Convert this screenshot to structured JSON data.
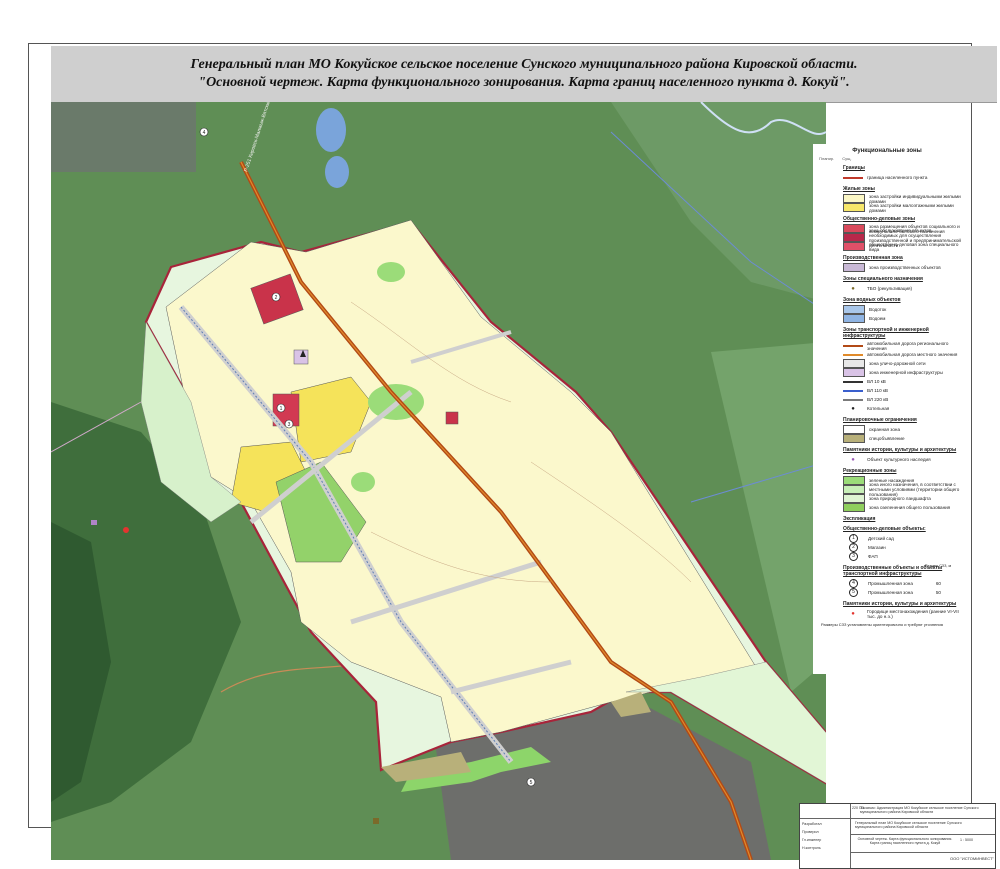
{
  "title": {
    "line1": "Генеральный план МО Кокуйское сельское поселение Сунского муниципального района Кировской области.",
    "line2": "\"Основной чертеж. Карта функционального зонирования. Карта границ населенного пункта д. Кокуй\"."
  },
  "map": {
    "road_label": "Р-251 Кировск-Малмыж-Вятские Поляны",
    "markers": [
      "1",
      "2",
      "3",
      "4",
      "5"
    ]
  },
  "legend": {
    "title": "Функциональные зоны",
    "col_headers": [
      "Планир.",
      "Сущ."
    ],
    "sections": [
      {
        "heading": "Границы",
        "items": [
          {
            "kind": "line",
            "color": "#c0392b",
            "label": "граница населенного пункта"
          }
        ]
      },
      {
        "heading": "Жилые зоны",
        "items": [
          {
            "kind": "fill",
            "color": "#fbf7c6",
            "label": "зона застройки индивидуальными жилыми домами"
          },
          {
            "kind": "fill",
            "color": "#f7e76a",
            "label": "зона застройки малоэтажными жилыми домами"
          }
        ]
      },
      {
        "heading": "Общественно-деловые зоны",
        "items": [
          {
            "kind": "fill",
            "color": "#d9495b",
            "label": "зона размещения объектов социального и коммунально-бытового назначения"
          },
          {
            "kind": "fill",
            "color": "#b8284a",
            "label": "зона обслуживания объектов, необходимых для осуществления производственной и предпринимательской деятельности"
          },
          {
            "kind": "fill",
            "color": "#e05068",
            "label": "общественно-деловая зона специального вида"
          }
        ]
      },
      {
        "heading": "Производственная зона",
        "items": [
          {
            "kind": "fill",
            "color": "#c9b9d6",
            "label": "зона производственных объектов"
          }
        ]
      },
      {
        "heading": "Зоны специального назначения",
        "items": [
          {
            "kind": "symbol",
            "color": "#7b6a2a",
            "label": "ТБО (рекультивация)"
          }
        ]
      },
      {
        "heading": "Зона водных объектов",
        "items": [
          {
            "kind": "fill",
            "color": "#a9c7ea",
            "label": "Водоток"
          },
          {
            "kind": "fill",
            "color": "#8fb4e3",
            "label": "Водоем"
          }
        ]
      },
      {
        "heading": "Зоны транспортной и инженерной инфраструктуры",
        "items": [
          {
            "kind": "line",
            "color": "#b24a16",
            "label": "автомобильная дорога регионального значения"
          },
          {
            "kind": "line",
            "color": "#e08a2a",
            "label": "автомобильная дорога местного значения"
          },
          {
            "kind": "fill",
            "color": "#e8e8e8",
            "label": "зона уличо-дорожной сети"
          },
          {
            "kind": "fill",
            "color": "#d9c3e6",
            "label": "зона инженерной инфраструктуры"
          },
          {
            "kind": "line",
            "color": "#333333",
            "label": "ВЛ 10 кВ"
          },
          {
            "kind": "line",
            "color": "#3a5fcd",
            "label": "ВЛ 110 кВ"
          },
          {
            "kind": "line",
            "color": "#7a7a7a",
            "label": "ВЛ 220 кВ"
          },
          {
            "kind": "symbol",
            "color": "#222222",
            "label": "Котельная"
          }
        ]
      },
      {
        "heading": "Планировочные ограничения",
        "items": [
          {
            "kind": "fill",
            "color": "#ffffff",
            "label": "охранная зона"
          },
          {
            "kind": "fill",
            "color": "#b8b07a",
            "label": "спецобъявление"
          }
        ]
      },
      {
        "heading": "Памятники истории, культуры и архитектуры",
        "items": [
          {
            "kind": "symbol",
            "color": "#9b59b6",
            "label": "Объект культурного наследия"
          }
        ]
      },
      {
        "heading": "Рекреационные зоны",
        "items": [
          {
            "kind": "fill",
            "color": "#9bdc79",
            "label": "зеленые насаждения"
          },
          {
            "kind": "fill",
            "color": "#c8efb8",
            "label": "зона иного назначения, в соответствии с местными условиями (территории общего пользования)"
          },
          {
            "kind": "fill",
            "color": "#dff4d3",
            "label": "зона природного ландшафта"
          },
          {
            "kind": "fill",
            "color": "#8fcf5d",
            "label": "зона озеленения общего пользования"
          }
        ]
      },
      {
        "heading": "Экспликация",
        "items": []
      },
      {
        "heading": "Общественно-деловые объекты:",
        "items": [
          {
            "kind": "num",
            "color": "#222222",
            "num": "1",
            "label": "Детский сад"
          },
          {
            "kind": "num",
            "color": "#222222",
            "num": "2",
            "label": "Магазин"
          },
          {
            "kind": "num",
            "color": "#222222",
            "num": "3",
            "label": "ФАП"
          }
        ]
      },
      {
        "heading": "Производственные объекты и объекты транспортной инфраструктуры",
        "items": [
          {
            "kind": "num",
            "color": "#222222",
            "num": "4",
            "label": "Промышленная зона",
            "extra": "60"
          },
          {
            "kind": "num",
            "color": "#222222",
            "num": "5",
            "label": "Промышленная зона",
            "extra": "50"
          }
        ]
      },
      {
        "heading": "Памятники истории, культуры и архитектуры",
        "items": [
          {
            "kind": "symbol",
            "color": "#e3342f",
            "label": "Городище местонахождения (ранние VI-VII тыс. до н.э.)"
          }
        ]
      }
    ],
    "szz_header": "Размер СЗЗ, м",
    "footnote": "Размеры СЗЗ установлены ориентировочно и требуют уточнения"
  },
  "stamp": {
    "line1": "Заказчик: Администрация МО Кокуйское сельское поселение Сунского муниципального района Кировской области",
    "line2": "Генеральный план МО Кокуйское сельское поселение Сунского муниципального района Кировской области",
    "line3": "Основной чертеж. Карта функционального зонирования. Карта границ населенного пункта д. Кокуй",
    "code": "220 ГП",
    "scale": "1 : 5000",
    "company": "ООО \"ИСТОМИНВЕСТ\"",
    "rows": [
      "Разработал",
      "Проверил",
      "Гл.инженер",
      "Н.контроль"
    ]
  }
}
